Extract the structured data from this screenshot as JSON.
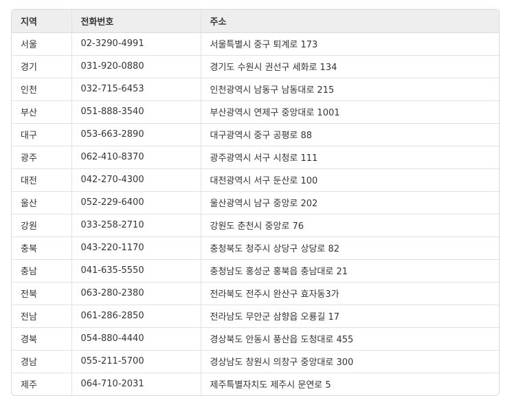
{
  "headers": [
    "지역",
    "전화번호",
    "주소"
  ],
  "rows": [
    {
      "region": "서울",
      "phone": "02-3290-4991",
      "address": "서울특별시 중구 퇴계로 173"
    },
    {
      "region": "경기",
      "phone": "031-920-0880",
      "address": "경기도 수원시 권선구 세화로 134"
    },
    {
      "region": "인천",
      "phone": "032-715-6453",
      "address": "인천광역시 남동구 남동대로 215"
    },
    {
      "region": "부산",
      "phone": "051-888-3540",
      "address": "부산광역시 연제구 중앙대로 1001"
    },
    {
      "region": "대구",
      "phone": "053-663-2890",
      "address": "대구광역시 중구 공평로 88"
    },
    {
      "region": "광주",
      "phone": "062-410-8370",
      "address": "광주광역시 서구 시청로 111"
    },
    {
      "region": "대전",
      "phone": "042-270-4300",
      "address": "대전광역시 서구 둔산로 100"
    },
    {
      "region": "울산",
      "phone": "052-229-6400",
      "address": "울산광역시 남구 중앙로 202"
    },
    {
      "region": "강원",
      "phone": "033-258-2710",
      "address": "강원도 춘천시 중앙로 76"
    },
    {
      "region": "충북",
      "phone": "043-220-1170",
      "address": "충청북도 청주시 상당구 상당로 82"
    },
    {
      "region": "충남",
      "phone": "041-635-5550",
      "address": "충청남도 홍성군 홍북읍 충남대로 21"
    },
    {
      "region": "전북",
      "phone": "063-280-2380",
      "address": "전라북도 전주시 완산구 효자동3가"
    },
    {
      "region": "전남",
      "phone": "061-286-2850",
      "address": "전라남도 무안군 삼향읍 오룡길 17"
    },
    {
      "region": "경북",
      "phone": "054-880-4440",
      "address": "경상북도 안동시 풍산읍 도청대로 455"
    },
    {
      "region": "경남",
      "phone": "055-211-5700",
      "address": "경상남도 창원시 의창구 중앙대로 300"
    },
    {
      "region": "제주",
      "phone": "064-710-2031",
      "address": "제주특별자치도 제주시 문연로 5"
    }
  ]
}
